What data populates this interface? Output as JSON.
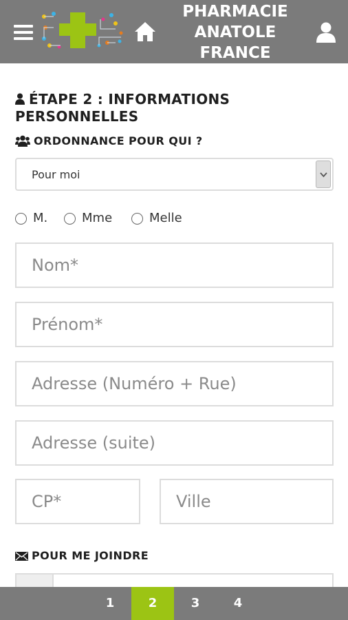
{
  "header": {
    "title_line1": "PHARMACIE",
    "title_line2": "ANATOLE",
    "title_line3": "FRANCE",
    "bg_color": "#7b7b7b",
    "accent_color": "#9cc414",
    "icons": {
      "menu": "hamburger-icon",
      "home": "home-icon",
      "user": "user-icon"
    }
  },
  "form": {
    "step_title_line1": "ÉTAPE 2 : INFORMATIONS",
    "step_title_line2": "PERSONNELLES",
    "ordonnance_label": "ORDONNANCE POUR QUI ?",
    "ordonnance_selected": "Pour moi",
    "civilite": [
      {
        "label": "M.",
        "checked": false
      },
      {
        "label": "Mme",
        "checked": false
      },
      {
        "label": "Melle",
        "checked": false
      }
    ],
    "fields": {
      "nom_placeholder": "Nom*",
      "prenom_placeholder": "Prénom*",
      "adresse_placeholder": "Adresse (Numéro + Rue)",
      "adresse_suite_placeholder": "Adresse (suite)",
      "cp_placeholder": "CP*",
      "ville_placeholder": "Ville"
    },
    "joindre_label": "POUR ME JOINDRE"
  },
  "pager": {
    "pages": [
      "1",
      "2",
      "3",
      "4"
    ],
    "active": "2"
  }
}
